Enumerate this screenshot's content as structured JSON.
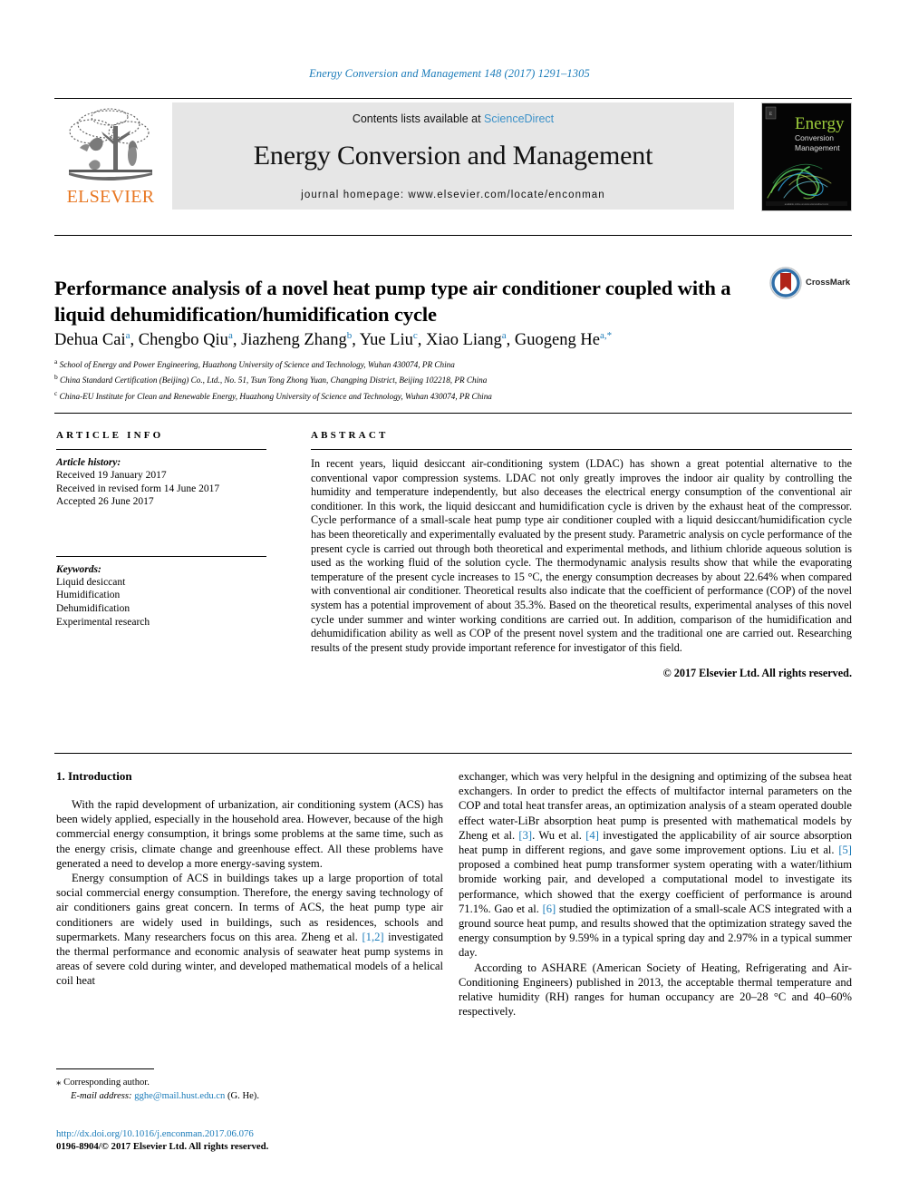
{
  "running_head": "Energy Conversion and Management 148 (2017) 1291–1305",
  "masthead": {
    "contents_prefix": "Contents lists available at ",
    "sciencedirect": "ScienceDirect",
    "journal_title": "Energy Conversion and Management",
    "homepage": "journal homepage: www.elsevier.com/locate/enconman",
    "publisher": "ELSEVIER",
    "cover": {
      "line1": "Energy",
      "line2": "Conversion",
      "line3": "Management"
    },
    "colors": {
      "link": "#3c91c8",
      "publisher_orange": "#e87722",
      "panel_gray": "#e6e6e6",
      "cover_green": "#9ccb3b"
    }
  },
  "article": {
    "title": "Performance analysis of a novel heat pump type air conditioner coupled with a liquid dehumidification/humidification cycle",
    "crossmark_label": "CrossMark",
    "authors": [
      {
        "name": "Dehua Cai",
        "sup": "a"
      },
      {
        "name": "Chengbo Qiu",
        "sup": "a"
      },
      {
        "name": "Jiazheng Zhang",
        "sup": "b"
      },
      {
        "name": "Yue Liu",
        "sup": "c"
      },
      {
        "name": "Xiao Liang",
        "sup": "a"
      },
      {
        "name": "Guogeng He",
        "sup": "a,*"
      }
    ],
    "affiliations": [
      {
        "mark": "a",
        "text": "School of Energy and Power Engineering, Huazhong University of Science and Technology, Wuhan 430074, PR China"
      },
      {
        "mark": "b",
        "text": "China Standard Certification (Beijing) Co., Ltd., No. 51, Tsun Tong Zhong Yuan, Changping District, Beijing 102218, PR China"
      },
      {
        "mark": "c",
        "text": "China-EU Institute for Clean and Renewable Energy, Huazhong University of Science and Technology, Wuhan 430074, PR China"
      }
    ]
  },
  "article_info": {
    "label": "ARTICLE INFO",
    "history_label": "Article history:",
    "history": [
      "Received 19 January 2017",
      "Received in revised form 14 June 2017",
      "Accepted 26 June 2017"
    ],
    "keywords_label": "Keywords:",
    "keywords": [
      "Liquid desiccant",
      "Humidification",
      "Dehumidification",
      "Experimental research"
    ]
  },
  "abstract": {
    "label": "ABSTRACT",
    "text": "In recent years, liquid desiccant air-conditioning system (LDAC) has shown a great potential alternative to the conventional vapor compression systems. LDAC not only greatly improves the indoor air quality by controlling the humidity and temperature independently, but also deceases the electrical energy consumption of the conventional air conditioner. In this work, the liquid desiccant and humidification cycle is driven by the exhaust heat of the compressor. Cycle performance of a small-scale heat pump type air conditioner coupled with a liquid desiccant/humidification cycle has been theoretically and experimentally evaluated by the present study. Parametric analysis on cycle performance of the present cycle is carried out through both theoretical and experimental methods, and lithium chloride aqueous solution is used as the working fluid of the solution cycle. The thermodynamic analysis results show that while the evaporating temperature of the present cycle increases to 15 °C, the energy consumption decreases by about 22.64% when compared with conventional air conditioner. Theoretical results also indicate that the coefficient of performance (COP) of the novel system has a potential improvement of about 35.3%. Based on the theoretical results, experimental analyses of this novel cycle under summer and winter working conditions are carried out. In addition, comparison of the humidification and dehumidification ability as well as COP of the present novel system and the traditional one are carried out. Researching results of the present study provide important reference for investigator of this field.",
    "copyright": "© 2017 Elsevier Ltd. All rights reserved."
  },
  "body": {
    "section_heading": "1. Introduction",
    "left_paragraphs": [
      "With the rapid development of urbanization, air conditioning system (ACS) has been widely applied, especially in the household area. However, because of the high commercial energy consumption, it brings some problems at the same time, such as the energy crisis, climate change and greenhouse effect. All these problems have generated a need to develop a more energy-saving system."
    ],
    "left_para2_a": "Energy consumption of ACS in buildings takes up a large proportion of total social commercial energy consumption. Therefore, the energy saving technology of air conditioners gains great concern. In terms of ACS, the heat pump type air conditioners are widely used in buildings, such as residences, schools and supermarkets. Many researchers focus on this area. Zheng et al. ",
    "left_cite1": "[1,2]",
    "left_para2_b": " investigated the thermal performance and economic analysis of seawater heat pump systems in areas of severe cold during winter, and developed mathematical models of a helical coil heat",
    "right_para1_a": "exchanger, which was very helpful in the designing and optimizing of the subsea heat exchangers. In order to predict the effects of multifactor internal parameters on the COP and total heat transfer areas, an optimization analysis of a steam operated double effect water-LiBr absorption heat pump is presented with mathematical models by Zheng et al. ",
    "right_cite3": "[3]",
    "right_para1_b": ". Wu et al. ",
    "right_cite4": "[4]",
    "right_para1_c": " investigated the applicability of air source absorption heat pump in different regions, and gave some improvement options. Liu et al. ",
    "right_cite5": "[5]",
    "right_para1_d": " proposed a combined heat pump transformer system operating with a water/lithium bromide working pair, and developed a computational model to investigate its performance, which showed that the exergy coefficient of performance is around 71.1%. Gao et al. ",
    "right_cite6": "[6]",
    "right_para1_e": " studied the optimization of a small-scale ACS integrated with a ground source heat pump, and results showed that the optimization strategy saved the energy consumption by 9.59% in a typical spring day and 2.97% in a typical summer day.",
    "right_para2": "According to ASHARE (American Society of Heating, Refrigerating and Air-Conditioning Engineers) published in 2013, the acceptable thermal temperature and relative humidity (RH) ranges for human occupancy are 20–28 °C and 40–60% respectively."
  },
  "footer": {
    "corresponding_star": "⁎",
    "corresponding_label": "Corresponding author.",
    "email_label": "E-mail address:",
    "email": "gghe@mail.hust.edu.cn",
    "email_owner": "(G. He).",
    "doi": "http://dx.doi.org/10.1016/j.enconman.2017.06.076",
    "issn": "0196-8904/© 2017 Elsevier Ltd. All rights reserved."
  }
}
